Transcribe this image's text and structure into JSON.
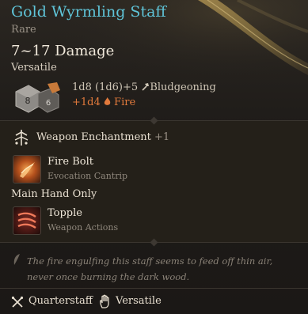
{
  "item": {
    "name": "Gold Wyrmling Staff",
    "rarity": "Rare",
    "damage": "7~17 Damage",
    "damage_category": "Versatile",
    "dice_values": [
      "8",
      "6"
    ],
    "damage_line1_main": "1d8 (1d6)+5",
    "damage_line1_type": "Bludgeoning",
    "damage_line2_main": "+1d4",
    "damage_line2_type": "Fire"
  },
  "enchantment": {
    "label": "Weapon Enchantment",
    "bonus": "+1"
  },
  "spells": [
    {
      "name": "Fire Bolt",
      "subtitle": "Evocation Cantrip",
      "icon": "fire-bolt-icon"
    },
    {
      "name": "Topple",
      "subtitle": "Weapon Actions",
      "icon": "topple-icon"
    }
  ],
  "main_hand_only": "Main Hand Only",
  "flavor": "The fire engulfing this staff seems to feed off thin air, never once burning the dark wood.",
  "properties": [
    {
      "label": "Quarterstaff",
      "icon": "crossed-staves-icon"
    },
    {
      "label": "Versatile",
      "icon": "hand-icon"
    }
  ],
  "colors": {
    "title": "#5fc4d8",
    "fire": "#e27a3c",
    "text": "#e8dfd0",
    "muted": "#9a9287"
  }
}
